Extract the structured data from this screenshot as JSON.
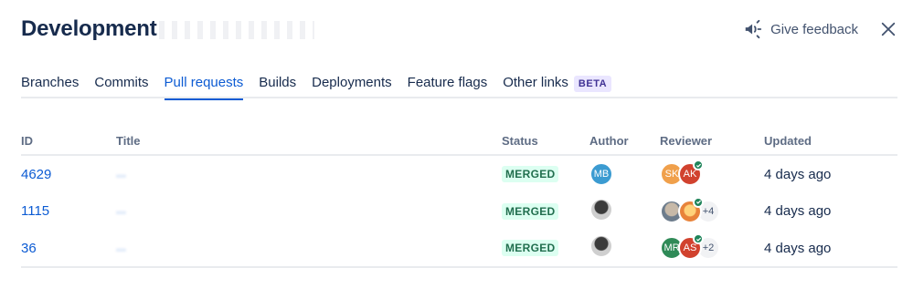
{
  "header": {
    "title": "Development",
    "feedback_label": "Give feedback"
  },
  "tabs": [
    {
      "label": "Branches"
    },
    {
      "label": "Commits"
    },
    {
      "label": "Pull requests"
    },
    {
      "label": "Builds"
    },
    {
      "label": "Deployments"
    },
    {
      "label": "Feature flags"
    },
    {
      "label": "Other links",
      "badge": "BETA"
    }
  ],
  "table": {
    "columns": [
      "ID",
      "Title",
      "Status",
      "Author",
      "Reviewer",
      "Updated"
    ],
    "rows": [
      {
        "id": "4629",
        "title": "...",
        "status": "MERGED",
        "author": {
          "initials": "MB",
          "color": "#3b9bd1"
        },
        "reviewers": [
          {
            "initials": "SK",
            "color": "#f0a04b",
            "approved": false
          },
          {
            "initials": "AK",
            "color": "#d1422e",
            "approved": true
          }
        ],
        "reviewers_more": "",
        "updated": "4 days ago"
      },
      {
        "id": "1115",
        "title": "...",
        "status": "MERGED",
        "author": {
          "initials": "",
          "color": "#bfbfbf"
        },
        "reviewers": [
          {
            "initials": "",
            "color": "#6d7c8c",
            "approved": false
          },
          {
            "initials": "",
            "color": "#e8833a",
            "approved": true
          }
        ],
        "reviewers_more": "+4",
        "updated": "4 days ago"
      },
      {
        "id": "36",
        "title": "...",
        "status": "MERGED",
        "author": {
          "initials": "",
          "color": "#bfbfbf"
        },
        "reviewers": [
          {
            "initials": "MR",
            "color": "#2f8a57",
            "approved": false
          },
          {
            "initials": "AS",
            "color": "#d1422e",
            "approved": true
          }
        ],
        "reviewers_more": "+2",
        "updated": "4 days ago"
      }
    ]
  },
  "colors": {
    "accent": "#0c5bd3",
    "merged_bg": "#dcfff1",
    "merged_text": "#216e4e",
    "beta_bg": "#eae6ff",
    "beta_text": "#403294"
  },
  "icons": {
    "feedback": "megaphone-icon",
    "close": "close-icon",
    "approved": "check-icon"
  }
}
